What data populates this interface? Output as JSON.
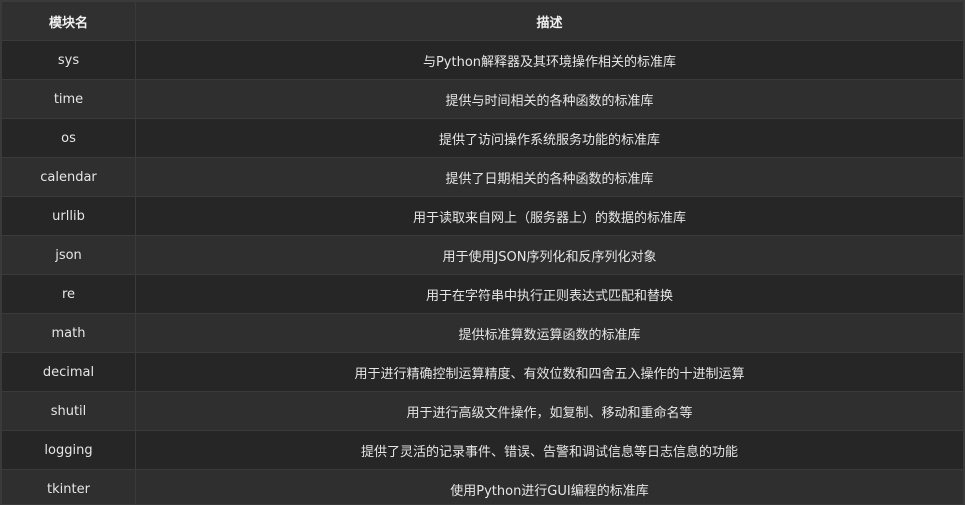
{
  "table": {
    "headers": [
      "模块名",
      "描述"
    ],
    "rows": [
      {
        "module": "sys",
        "description": "与Python解释器及其环境操作相关的标准库"
      },
      {
        "module": "time",
        "description": "提供与时间相关的各种函数的标准库"
      },
      {
        "module": "os",
        "description": "提供了访问操作系统服务功能的标准库"
      },
      {
        "module": "calendar",
        "description": "提供了日期相关的各种函数的标准库"
      },
      {
        "module": "urllib",
        "description": "用于读取来自网上（服务器上）的数据的标准库"
      },
      {
        "module": "json",
        "description": "用于使用JSON序列化和反序列化对象"
      },
      {
        "module": "re",
        "description": "用于在字符串中执行正则表达式匹配和替换"
      },
      {
        "module": "math",
        "description": "提供标准算数运算函数的标准库"
      },
      {
        "module": "decimal",
        "description": "用于进行精确控制运算精度、有效位数和四舍五入操作的十进制运算"
      },
      {
        "module": "shutil",
        "description": "用于进行高级文件操作，如复制、移动和重命名等"
      },
      {
        "module": "logging",
        "description": "提供了灵活的记录事件、错误、告警和调试信息等日志信息的功能"
      },
      {
        "module": "tkinter",
        "description": "使用Python进行GUI编程的标准库"
      }
    ]
  },
  "colors": {
    "background": "#262626",
    "header_background": "#303030",
    "row_alt_background": "#2f2f2f",
    "border": "#3a3a3a",
    "text": "#e6e6e6"
  }
}
